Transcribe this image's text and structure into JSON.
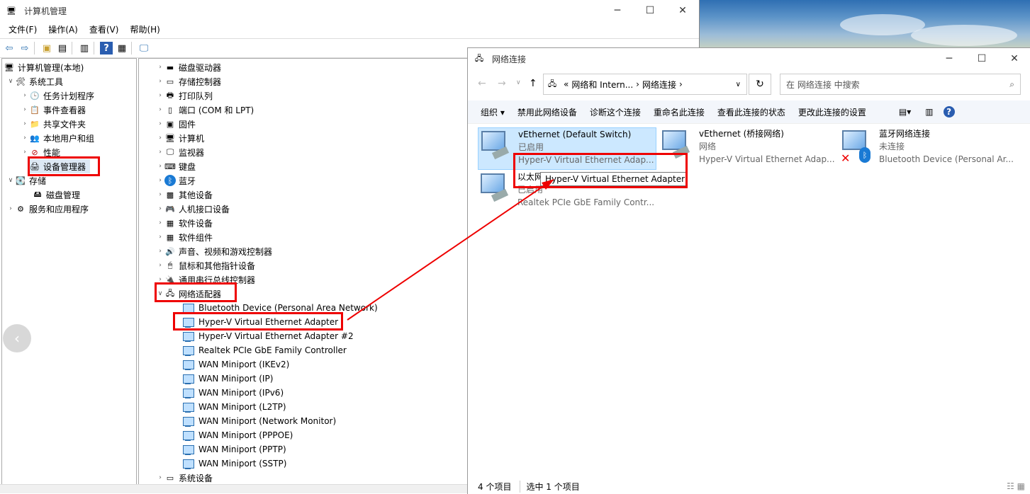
{
  "computer_management": {
    "title": "计算机管理",
    "menu": [
      "文件(F)",
      "操作(A)",
      "查看(V)",
      "帮助(H)"
    ],
    "left_tree": [
      {
        "label": "计算机管理(本地)",
        "level": 0
      },
      {
        "label": "系统工具",
        "level": 1
      },
      {
        "label": "任务计划程序",
        "level": 2
      },
      {
        "label": "事件查看器",
        "level": 2
      },
      {
        "label": "共享文件夹",
        "level": 2
      },
      {
        "label": "本地用户和组",
        "level": 2
      },
      {
        "label": "性能",
        "level": 2
      },
      {
        "label": "设备管理器",
        "level": 2
      },
      {
        "label": "存储",
        "level": 1
      },
      {
        "label": "磁盘管理",
        "level": 2
      },
      {
        "label": "服务和应用程序",
        "level": 1
      }
    ],
    "device_categories": [
      "磁盘驱动器",
      "存储控制器",
      "打印队列",
      "端口 (COM 和 LPT)",
      "固件",
      "计算机",
      "监视器",
      "键盘",
      "蓝牙",
      "其他设备",
      "人机接口设备",
      "软件设备",
      "软件组件",
      "声音、视频和游戏控制器",
      "鼠标和其他指针设备",
      "通用串行总线控制器",
      "网络适配器"
    ],
    "network_adapters": [
      "Bluetooth Device (Personal Area Network)",
      "Hyper-V Virtual Ethernet Adapter",
      "Hyper-V Virtual Ethernet Adapter #2",
      "Realtek PCIe GbE Family Controller",
      "WAN Miniport (IKEv2)",
      "WAN Miniport (IP)",
      "WAN Miniport (IPv6)",
      "WAN Miniport (L2TP)",
      "WAN Miniport (Network Monitor)",
      "WAN Miniport (PPPOE)",
      "WAN Miniport (PPTP)",
      "WAN Miniport (SSTP)"
    ],
    "last_category": "系统设备"
  },
  "network_connections": {
    "title": "网络连接",
    "breadcrumb": [
      "«",
      "网络和 Intern...",
      "网络连接"
    ],
    "search_placeholder": "在 网络连接 中搜索",
    "toolbar": [
      "组织 ▾",
      "禁用此网络设备",
      "诊断这个连接",
      "重命名此连接",
      "查看此连接的状态",
      "更改此连接的设置"
    ],
    "connections": [
      {
        "name": "vEthernet (Default Switch)",
        "status": "已启用",
        "device": "Hyper-V Virtual Ethernet Adap..."
      },
      {
        "name": "vEthernet (桥接网络)",
        "status": "网络",
        "device": "Hyper-V Virtual Ethernet Adap..."
      },
      {
        "name": "蓝牙网络连接",
        "status": "未连接",
        "device": "Bluetooth Device (Personal Ar..."
      },
      {
        "name": "以太网",
        "status": "已启用",
        "device": "Realtek PCIe GbE Family Contr..."
      }
    ],
    "tooltip": "Hyper-V Virtual Ethernet Adapter",
    "status_items": "4 个项目",
    "status_selected": "选中 1 个项目"
  },
  "colors": {
    "highlight_red": "#e00000",
    "selection_blue": "#cce8ff"
  }
}
